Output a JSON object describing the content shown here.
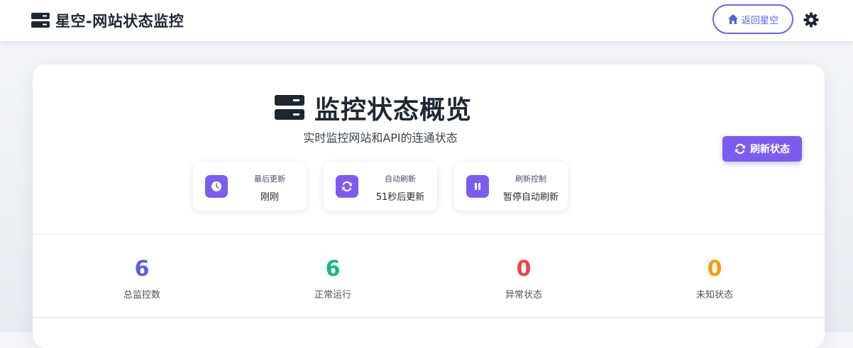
{
  "navbar": {
    "brand_icon": "server-icon",
    "brand_title": "星空-网站状态监控",
    "back_button": {
      "icon": "home-icon",
      "label": "返回星空"
    },
    "theme_toggle_icon": "gear-icon"
  },
  "overview": {
    "title_icon": "server-icon",
    "title": "监控状态概览",
    "subtitle": "实时监控网站和API的连通状态",
    "refresh_button": {
      "icon": "refresh-icon",
      "label": "刷新状态"
    }
  },
  "info_cards": [
    {
      "icon": "clock-icon",
      "label": "最后更新",
      "value": "刚刚"
    },
    {
      "icon": "sync-icon",
      "label": "自动刷新",
      "value": "51秒后更新"
    },
    {
      "icon": "pause-icon",
      "label": "刷新控制",
      "value": "暂停自动刷新"
    }
  ],
  "stats": [
    {
      "value": "6",
      "label": "总监控数",
      "color": "#5b5fe0"
    },
    {
      "value": "6",
      "label": "正常运行",
      "color": "#10b981"
    },
    {
      "value": "0",
      "label": "异常状态",
      "color": "#ef4444"
    },
    {
      "value": "0",
      "label": "未知状态",
      "color": "#f59e0b"
    }
  ],
  "colors": {
    "accent": "#7c5cf0",
    "outline_accent": "#6366f1",
    "text_dark": "#1f2733"
  }
}
